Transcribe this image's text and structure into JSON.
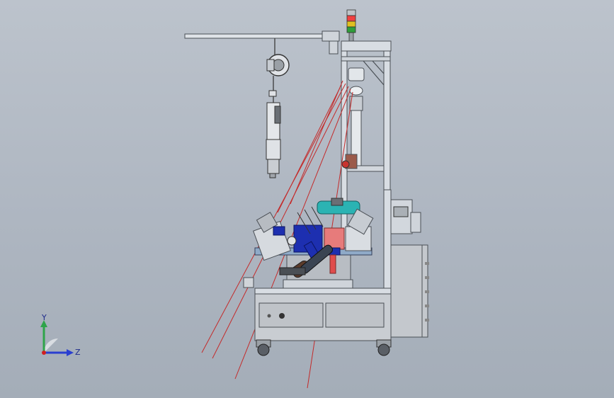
{
  "triad": {
    "y_label": "Y",
    "z_label": "Z"
  },
  "colors": {
    "background_top": "#bcc3cc",
    "background_bottom": "#a4adb8",
    "frame": "#d8dde3",
    "frame_edge": "#4a4f55",
    "cabinet": "#c4c8cd",
    "blue_parts": "#1d2fb0",
    "teal_part": "#2bb3b3",
    "red_lines": "#c42a2a",
    "light_red": "#f04040",
    "light_yellow": "#e0c020",
    "light_green": "#2f9e3a",
    "axis_y": "#2fa44a",
    "axis_z": "#2a3fd0",
    "axis_origin": "#d02020"
  },
  "icons": {
    "signal_tower": "signal-tower-icon",
    "screwdriver": "screwdriver-icon",
    "caster_wheel": "caster-wheel-icon"
  }
}
